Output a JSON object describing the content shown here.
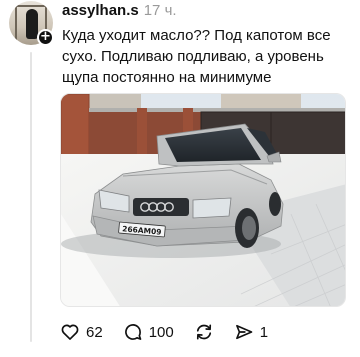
{
  "post": {
    "username": "assylhan.s",
    "time": "17 ч.",
    "text": "Куда уходит масло?? Под капотом все сухо. Подливаю подливаю, а уровень щупа постоянно на минимуме",
    "image": {
      "plate_text": "266AM09"
    },
    "actions": {
      "likes": "62",
      "comments": "100",
      "shares": "1"
    }
  },
  "icons": [
    "plus-icon",
    "heart-icon",
    "comment-icon",
    "repost-icon",
    "share-icon"
  ],
  "colors": {
    "text": "#111111",
    "muted": "#9a9a9a",
    "car": "#c8c9c9"
  }
}
